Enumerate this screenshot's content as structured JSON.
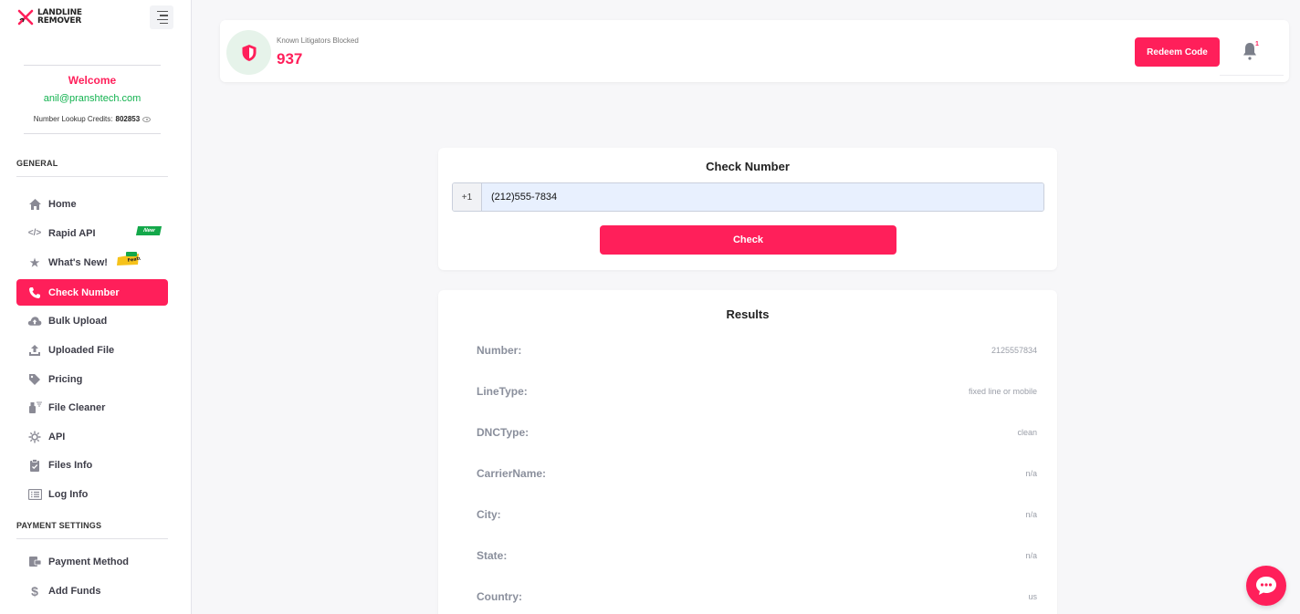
{
  "brand": {
    "line1": "LANDLINE",
    "line2": "REMOVER",
    "accent": "#ff1f5a"
  },
  "user": {
    "welcome": "Welcome",
    "email": "anil@pranshtech.com",
    "credits_label": "Number Lookup Credits:",
    "credits_value": "802853"
  },
  "sidebar": {
    "general_label": "GENERAL",
    "payment_label": "PAYMENT SETTINGS",
    "items": [
      {
        "label": "Home",
        "icon": "home-icon"
      },
      {
        "label": "Rapid API",
        "icon": "code-icon",
        "badge": "New"
      },
      {
        "label": "What's New!",
        "icon": "star-icon",
        "badge": "New Feature"
      },
      {
        "label": "Check Number",
        "icon": "phone-icon",
        "active": true
      },
      {
        "label": "Bulk Upload",
        "icon": "cloud-upload-icon"
      },
      {
        "label": "Uploaded File",
        "icon": "upload-icon"
      },
      {
        "label": "Pricing",
        "icon": "tag-icon"
      },
      {
        "label": "File Cleaner",
        "icon": "spray-icon"
      },
      {
        "label": "API",
        "icon": "api-icon"
      },
      {
        "label": "Files Info",
        "icon": "clipboard-icon"
      },
      {
        "label": "Log Info",
        "icon": "list-icon"
      }
    ],
    "payment_items": [
      {
        "label": "Payment Method",
        "icon": "payment-icon"
      },
      {
        "label": "Add Funds",
        "icon": "dollar-icon"
      }
    ]
  },
  "header": {
    "stat_label": "Known Litigators Blocked",
    "stat_value": "937",
    "redeem_label": "Redeem Code",
    "notification_count": "1"
  },
  "check": {
    "title": "Check Number",
    "prefix": "+1",
    "phone_value": "(212)555-7834",
    "button_label": "Check"
  },
  "results": {
    "title": "Results",
    "rows": [
      {
        "label": "Number:",
        "value": "2125557834"
      },
      {
        "label": "LineType:",
        "value": "fixed line or mobile"
      },
      {
        "label": "DNCType:",
        "value": "clean"
      },
      {
        "label": "CarrierName:",
        "value": "n/a"
      },
      {
        "label": "City:",
        "value": "n/a"
      },
      {
        "label": "State:",
        "value": "n/a"
      },
      {
        "label": "Country:",
        "value": "us"
      }
    ]
  }
}
